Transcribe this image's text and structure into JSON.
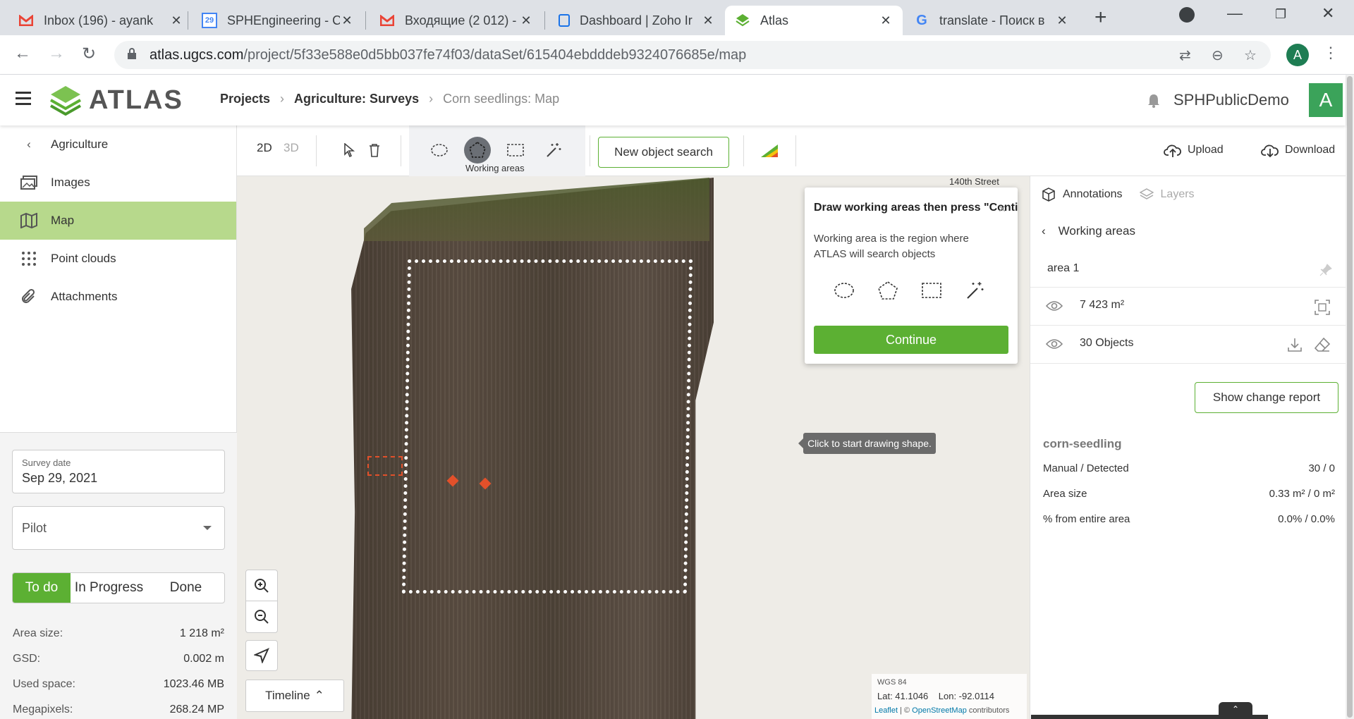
{
  "browser": {
    "tabs": [
      {
        "title": "Inbox (196) - ayank"
      },
      {
        "title": "SPHEngineering - C"
      },
      {
        "title": "Входящие (2 012) -"
      },
      {
        "title": "Dashboard | Zoho Ir"
      },
      {
        "title": "Atlas"
      },
      {
        "title": "translate - Поиск в"
      }
    ],
    "url_host": "atlas.ugcs.com",
    "url_path": "/project/5f33e588e0d5bb037fe74f03/dataSet/615404ebdddeb9324076685e/map",
    "profile_initial": "A"
  },
  "header": {
    "logo_text": "ATLAS",
    "breadcrumb": [
      "Projects",
      "Agriculture: Surveys",
      "Corn seedlings: Map"
    ],
    "user_name": "SPHPublicDemo",
    "avatar_initial": "A"
  },
  "sidebar": {
    "back_label": "Agriculture",
    "items": [
      {
        "label": "Images",
        "icon": "images-icon"
      },
      {
        "label": "Map",
        "icon": "map-icon",
        "active": true
      },
      {
        "label": "Point clouds",
        "icon": "point-cloud-icon"
      },
      {
        "label": "Attachments",
        "icon": "attachment-icon"
      }
    ],
    "survey_date_label": "Survey date",
    "survey_date": "Sep 29, 2021",
    "pilot_placeholder": "Pilot",
    "status": [
      "To do",
      "In Progress",
      "Done"
    ],
    "stats": [
      {
        "label": "Area size:",
        "value": "1 218 m²"
      },
      {
        "label": "GSD:",
        "value": "0.002 m"
      },
      {
        "label": "Used space:",
        "value": "1023.46 MB"
      },
      {
        "label": "Megapixels:",
        "value": "268.24 MP"
      }
    ]
  },
  "toolbar": {
    "mode_2d": "2D",
    "mode_3d": "3D",
    "working_areas_label": "Working areas",
    "new_search": "New object search",
    "upload": "Upload",
    "download": "Download"
  },
  "map": {
    "street_label": "140th Street",
    "tooltip": "Click to start drawing shape.",
    "timeline": "Timeline",
    "crs": "WGS 84",
    "lat": "Lat: 41.1046",
    "lon": "Lon: -92.0114",
    "attribution_leaflet": "Leaflet",
    "attribution_sep": " | © ",
    "attribution_osm": "OpenStreetMap",
    "attribution_tail": " contributors"
  },
  "popup": {
    "title": "Draw working areas then press \"Continue\"",
    "description": "Working area is the region where ATLAS will search objects",
    "continue": "Continue"
  },
  "right_panel": {
    "tab_annotations": "Annotations",
    "tab_layers": "Layers",
    "section": "Working areas",
    "area_name": "area 1",
    "area_value": "7 423 m²",
    "objects": "30 Objects",
    "change_report": "Show change report",
    "category": "corn-seedling",
    "kv": [
      {
        "label": "Manual / Detected",
        "value": "30 / 0"
      },
      {
        "label": "Area size",
        "value": "0.33 m² / 0 m²"
      },
      {
        "label": "% from entire area",
        "value": "0.0% / 0.0%"
      }
    ]
  },
  "colors": {
    "accent": "#5cb033",
    "active_nav": "#b7d98c"
  }
}
